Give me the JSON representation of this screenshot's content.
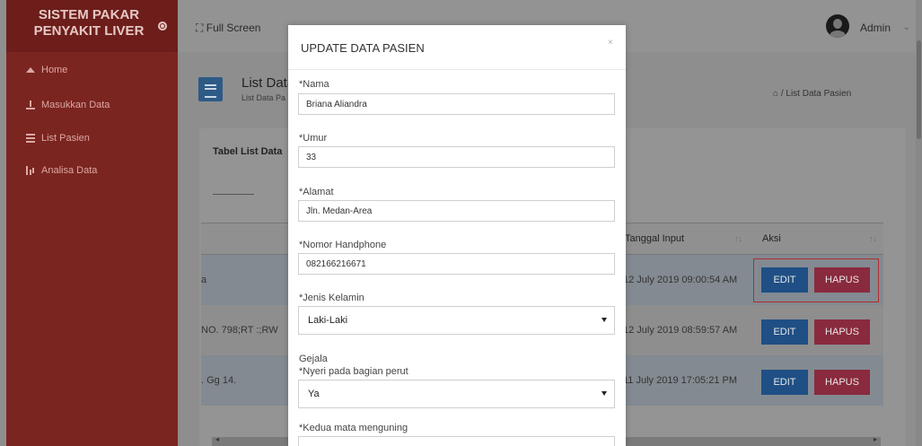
{
  "sidebar": {
    "brand_line1": "SISTEM PAKAR",
    "brand_line2": "PENYAKIT LIVER",
    "items": [
      {
        "label": "Home",
        "icon": "home-icon"
      },
      {
        "label": "Masukkan Data",
        "icon": "upload-icon"
      },
      {
        "label": "List Pasien",
        "icon": "list-icon"
      },
      {
        "label": "Analisa Data",
        "icon": "bar-chart-icon"
      }
    ]
  },
  "header": {
    "fullscreen_label": "Full Screen",
    "user_name": "Admin"
  },
  "page": {
    "title": "List Data",
    "subtitle": "List Data Pa",
    "breadcrumb": "List Data Pasien",
    "card_title": "Tabel List Data"
  },
  "table": {
    "columns": [
      "Tanggal Input",
      "Aksi"
    ],
    "rows": [
      {
        "address": "a",
        "date": "12 July 2019 09:00:54 AM"
      },
      {
        "address": "NO. 798;RT :;RW",
        "date": "12 July 2019 08:59:57 AM"
      },
      {
        "address": ". Gg 14.",
        "date": "11 July 2019 17:05:21 PM"
      }
    ],
    "edit_label": "EDIT",
    "delete_label": "HAPUS"
  },
  "modal": {
    "title": "UPDATE DATA PASIEN",
    "close": "×",
    "nama_label": "*Nama",
    "nama_value": "Briana Aliandra",
    "umur_label": "*Umur",
    "umur_value": "33",
    "alamat_label": "*Alamat",
    "alamat_value": "Jln. Medan-Area",
    "hp_label": "*Nomor Handphone",
    "hp_value": "082166216671",
    "jk_label": "*Jenis Kelamin",
    "jk_value": "Laki-Laki",
    "gejala_label": "Gejala",
    "nyeri_label": "*Nyeri pada bagian perut",
    "nyeri_value": "Ya",
    "mata_label": "*Kedua mata menguning"
  },
  "colors": {
    "sidebar": "#7b2520",
    "edit_button": "#1f4f85",
    "delete_button": "#8a2a3e"
  }
}
